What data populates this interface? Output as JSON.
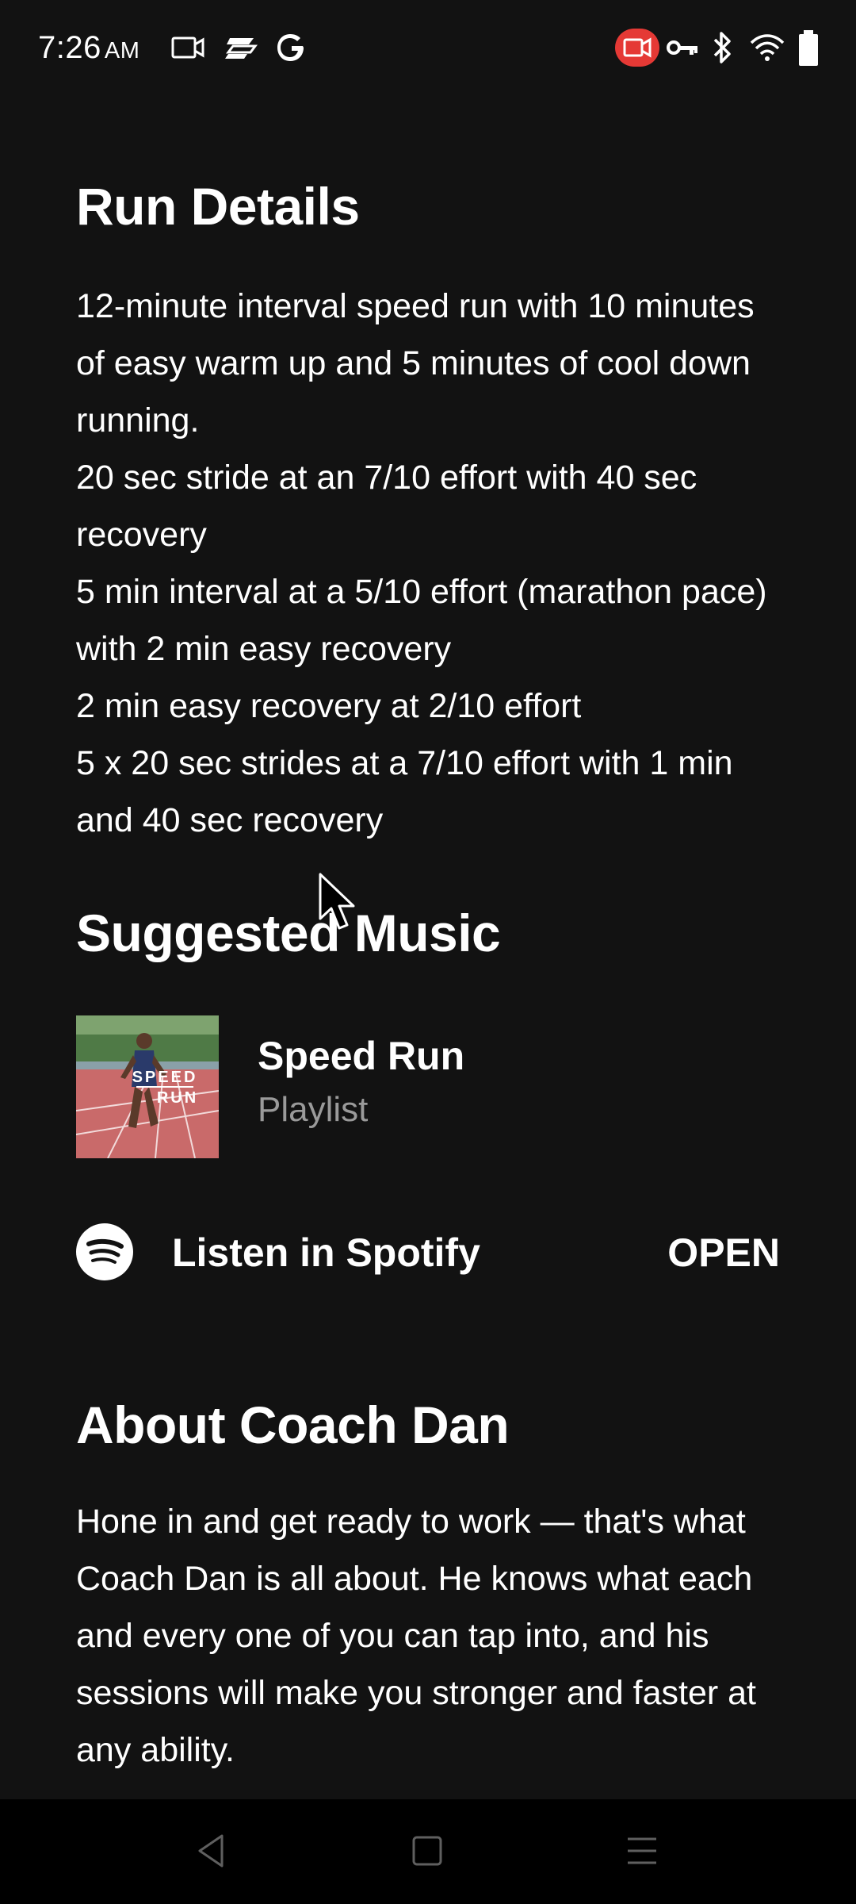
{
  "status_bar": {
    "time": "7:26",
    "ampm": "AM",
    "icons": [
      "video-icon",
      "cast-icon",
      "google-icon",
      "screen-record-icon",
      "vpn-key-icon",
      "bluetooth-icon",
      "wifi-icon",
      "battery-icon"
    ],
    "record_color": "#e53935"
  },
  "run_details": {
    "title": "Run Details",
    "lines": [
      "12-minute interval speed run with 10 minutes of easy warm up and 5 minutes of cool down running.",
      "20 sec stride at an 7/10 effort with 40 sec recovery",
      "5 min interval at a 5/10 effort (marathon pace) with 2 min easy recovery",
      "2 min easy recovery at 2/10 effort",
      "5 x 20 sec strides at a 7/10 effort with 1 min and 40 sec recovery"
    ]
  },
  "suggested_music": {
    "title": "Suggested Music",
    "playlist": {
      "title": "Speed Run",
      "subtitle": "Playlist",
      "cover_text_line1": "SPEED",
      "cover_text_line2": "RUN"
    },
    "spotify": {
      "label": "Listen in Spotify",
      "action": "OPEN"
    }
  },
  "about": {
    "title": "About Coach Dan",
    "text": "Hone in and get ready to work — that's what Coach Dan is all about. He knows what each and every one of you can tap into, and his sessions will make you stronger and faster at any ability."
  },
  "nav_bar": {
    "buttons": [
      "back-icon",
      "home-icon",
      "recents-icon"
    ]
  },
  "colors": {
    "background": "#121212",
    "text": "#ffffff",
    "secondary_text": "#9a9a9a",
    "nav_background": "#000000"
  }
}
